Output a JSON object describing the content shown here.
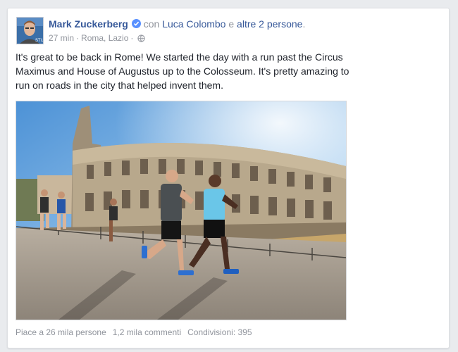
{
  "post": {
    "author": "Mark Zuckerberg",
    "with_label": "con",
    "tagged_friend": "Luca Colombo",
    "and_label": "e",
    "others": "altre 2 persone",
    "period": ".",
    "time": "27 min",
    "separator": "·",
    "location": "Roma, Lazio",
    "text": "It's great to be back in Rome! We started the day with a run past the Circus Maximus and House of Augustus up to the Colosseum. It's pretty amazing to run on roads in the city that helped invent them.",
    "icons": {
      "verified": "verified-badge-icon",
      "audience": "globe-icon"
    },
    "colors": {
      "link": "#365899",
      "muted": "#90949c",
      "text": "#1d2129",
      "verified": "#5890ff"
    }
  },
  "footer": {
    "likes": "Piace a 26 mila persone",
    "comments": "1,2 mila commenti",
    "shares": "Condivisioni: 395"
  }
}
